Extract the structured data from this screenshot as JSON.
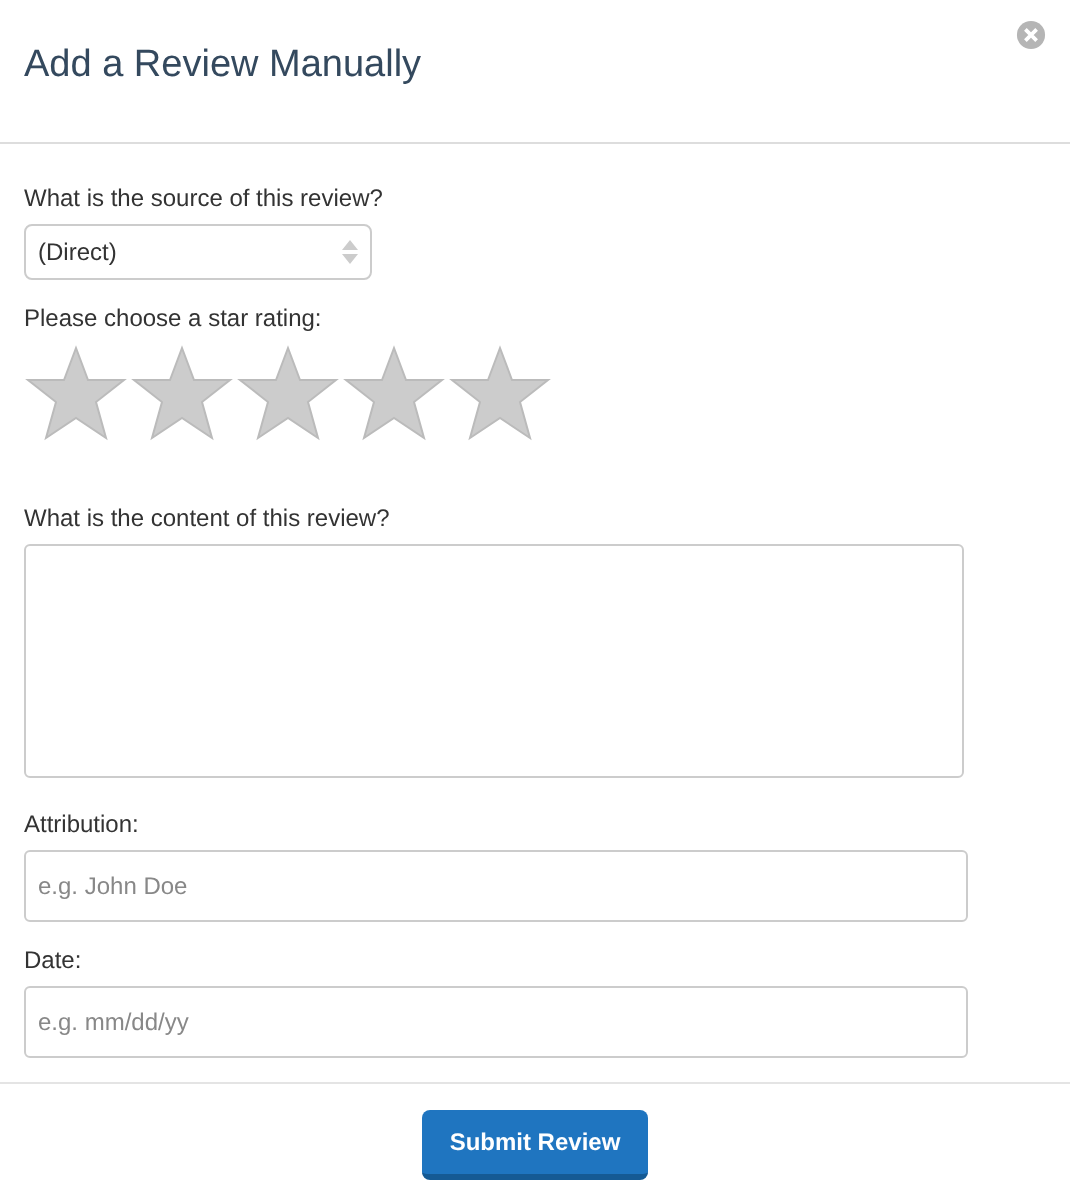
{
  "dialog": {
    "title": "Add a Review Manually"
  },
  "source": {
    "label": "What is the source of this review?",
    "value": "(Direct)"
  },
  "rating": {
    "label": "Please choose a star rating:",
    "stars": 0
  },
  "content": {
    "label": "What is the content of this review?"
  },
  "attribution": {
    "label": "Attribution:",
    "placeholder": "e.g. John Doe"
  },
  "date": {
    "label": "Date:",
    "placeholder": "e.g. mm/dd/yy"
  },
  "submit": {
    "label": "Submit Review"
  }
}
